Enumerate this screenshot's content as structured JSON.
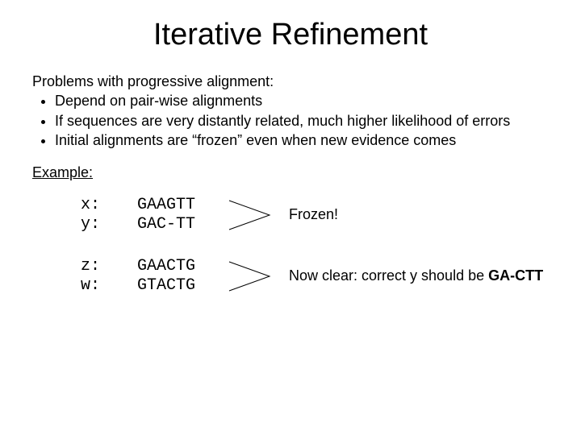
{
  "title": "Iterative Refinement",
  "intro": "Problems with progressive alignment:",
  "bullets": [
    "Depend on pair-wise alignments",
    "If sequences are very distantly related, much higher likelihood of errors",
    "Initial alignments are “frozen” even when new evidence comes"
  ],
  "example_label": "Example:",
  "rows": [
    {
      "label1": "x:",
      "label2": "y:",
      "seq1": "GAAGTT",
      "seq2": "GAC-TT",
      "caption_prefix": "Frozen!",
      "caption_suffix": "",
      "caption_bold": ""
    },
    {
      "label1": "z:",
      "label2": "w:",
      "seq1": "GAACTG",
      "seq2": "GTACTG",
      "caption_prefix": "Now clear: correct y should be ",
      "caption_suffix": "",
      "caption_bold": "GA-CTT"
    }
  ]
}
